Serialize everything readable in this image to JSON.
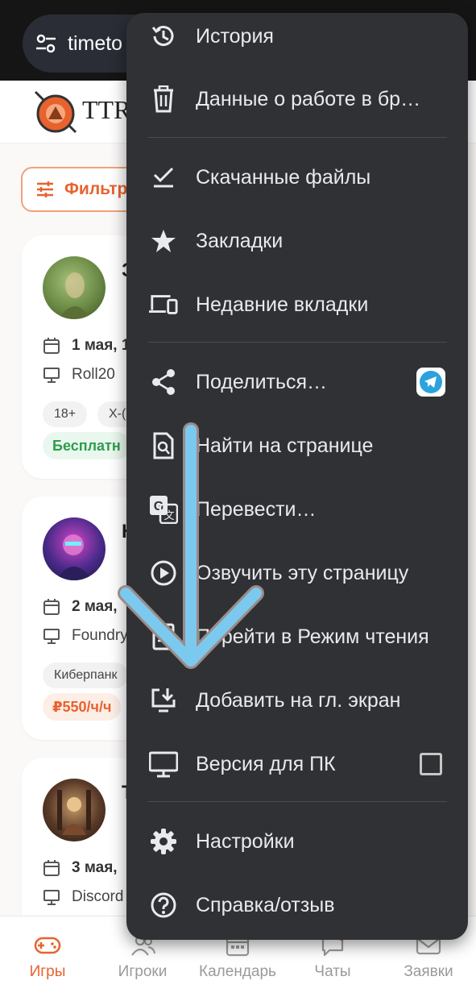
{
  "browser": {
    "url": "timeto"
  },
  "site": {
    "logo_text": "TTRP"
  },
  "filter": {
    "label": "Фильтр"
  },
  "cards": [
    {
      "title_initial": "З",
      "date": "1 мая, 1",
      "platform": "Roll20",
      "tags": [
        "18+",
        "X-("
      ],
      "price": "Бесплатн",
      "price_color": "#2e9d4c",
      "price_bg": "#eaf7ee"
    },
    {
      "title_initial": "Н",
      "date": "2 мая,",
      "platform": "Foundry",
      "tags": [
        "Киберпанк"
      ],
      "price": "₽550/ч/ч",
      "price_color": "#e8622e",
      "price_bg": "#fdeee6"
    },
    {
      "title_initial": "Т",
      "date": "3 мая,",
      "platform": "Discord",
      "tags": [],
      "price": "",
      "price_color": "#333",
      "price_bg": "#fff"
    }
  ],
  "bottom_nav": [
    {
      "label": "Игры",
      "icon": "gamepad-icon",
      "active": true
    },
    {
      "label": "Игроки",
      "icon": "people-icon",
      "active": false
    },
    {
      "label": "Календарь",
      "icon": "calendar-icon",
      "active": false
    },
    {
      "label": "Чаты",
      "icon": "chat-icon",
      "active": false
    },
    {
      "label": "Заявки",
      "icon": "mail-icon",
      "active": false
    }
  ],
  "menu": {
    "items": [
      {
        "label": "История",
        "icon": "history-icon"
      },
      {
        "label": "Данные  о работе в бр…",
        "icon": "trash-icon"
      },
      {
        "label": "Скачанные файлы",
        "icon": "download-check-icon"
      },
      {
        "label": "Закладки",
        "icon": "star-icon"
      },
      {
        "label": "Недавние вкладки",
        "icon": "devices-icon"
      },
      {
        "label": "Поделиться…",
        "icon": "share-icon"
      },
      {
        "label": "Найти на странице",
        "icon": "find-in-page-icon"
      },
      {
        "label": "Перевести…",
        "icon": "translate-icon"
      },
      {
        "label": "Озвучить эту страницу",
        "icon": "play-circle-icon"
      },
      {
        "label": "Перейти в Режим чтения",
        "icon": "reader-mode-icon"
      },
      {
        "label": "Добавить на гл. экран",
        "icon": "add-to-home-icon"
      },
      {
        "label": "Версия для ПК",
        "icon": "desktop-icon",
        "checked": false
      },
      {
        "label": "Настройки",
        "icon": "gear-icon"
      },
      {
        "label": "Справка/отзыв",
        "icon": "help-icon"
      }
    ]
  },
  "colors": {
    "accent": "#e8622e",
    "menu_bg": "#303134",
    "arrow": "#7cc9f0"
  }
}
